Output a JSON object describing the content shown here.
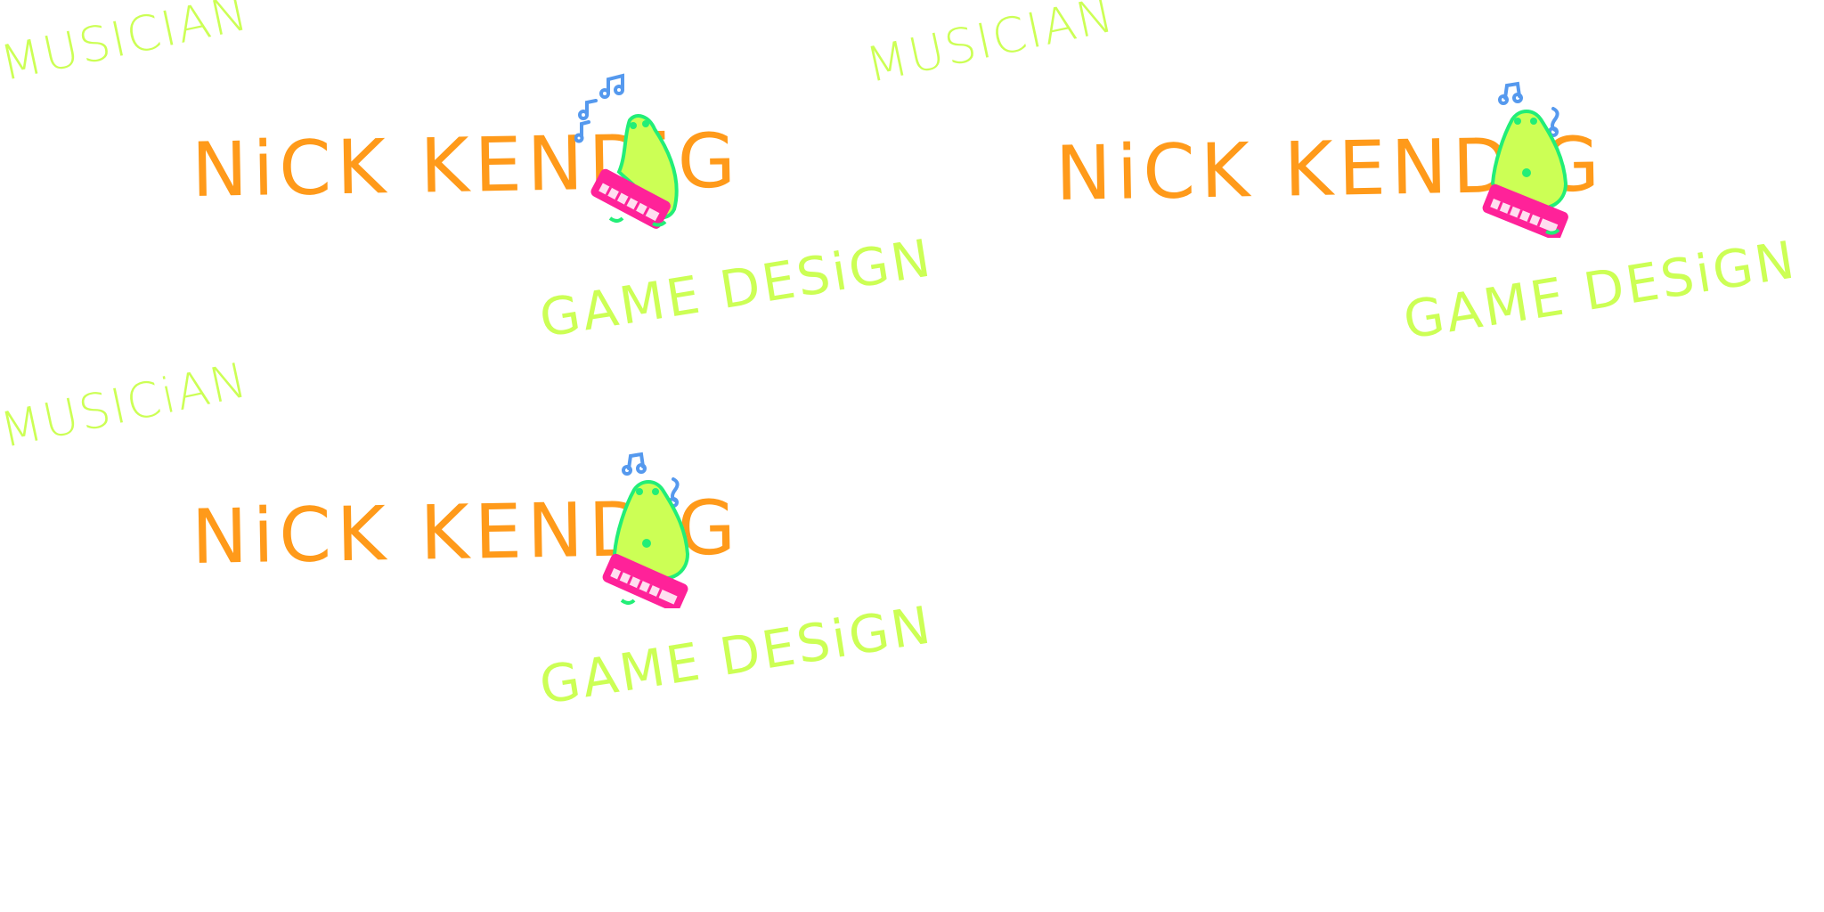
{
  "colors": {
    "name": "#ff9a1a",
    "tag": "#ccff55",
    "mascot_body": "#ccff55",
    "mascot_outline": "#22ee77",
    "keyboard": "#ff2299",
    "notes": "#5599ee"
  },
  "tiles": [
    {
      "tagline_top": "MUSICIAN",
      "name": "NiCK KENDiG",
      "tagline_bottom": "GAME DESiGN",
      "icon": "frog-keyboard-icon"
    },
    {
      "tagline_top": "MUSICIAN",
      "name": "NiCK KENDiG",
      "tagline_bottom": "GAME DESiGN",
      "icon": "frog-keyboard-icon"
    },
    {
      "tagline_top": "MUSICiAN",
      "name": "NiCK KENDiG",
      "tagline_bottom": "GAME DESiGN",
      "icon": "frog-keyboard-icon"
    }
  ]
}
